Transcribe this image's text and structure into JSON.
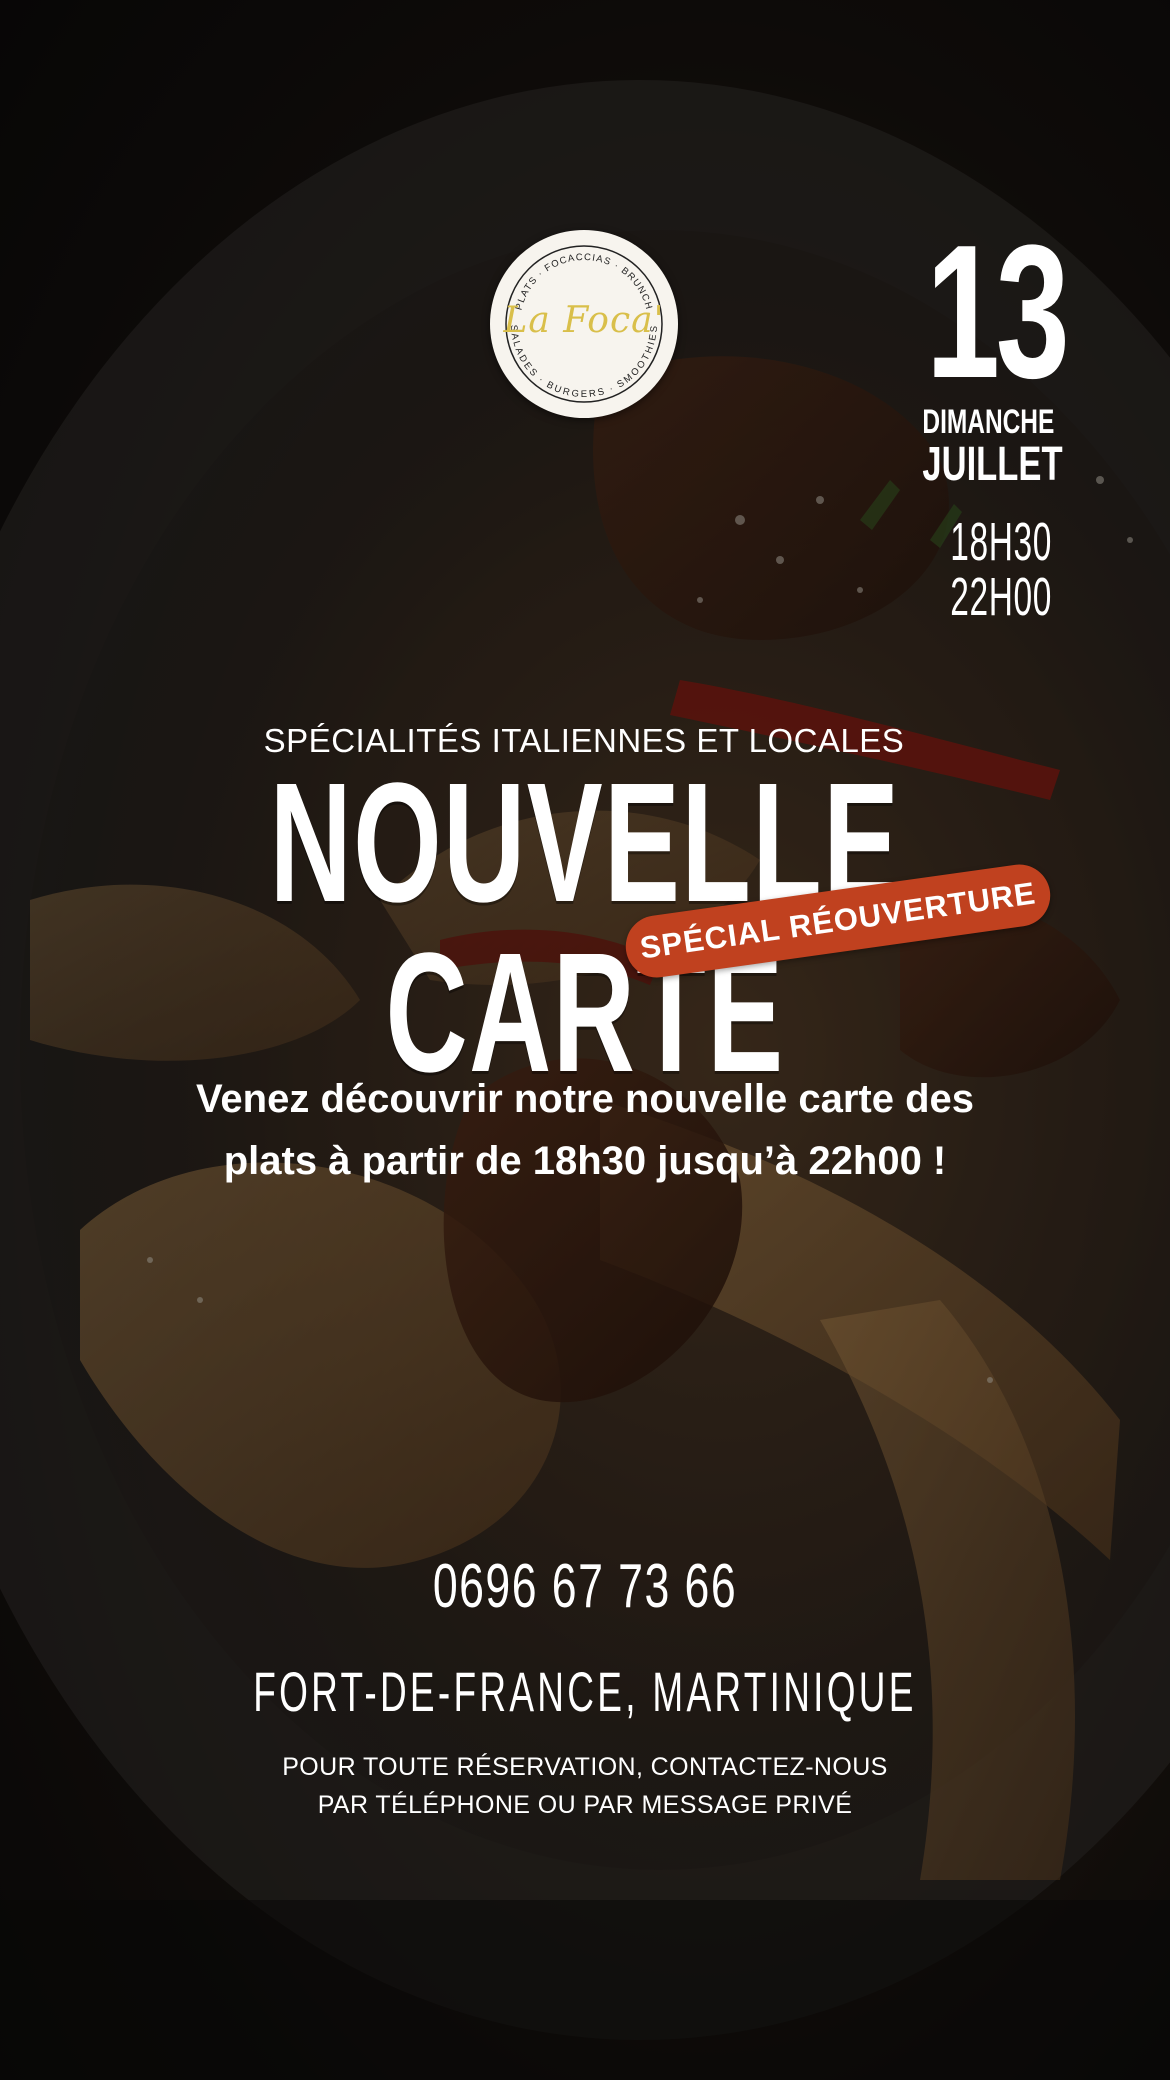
{
  "logo": {
    "brand": "La Foca'",
    "arc_top": "PLATS · FOCACCIAS · BRUNCH",
    "arc_bottom": "SALADES · BURGERS · SMOOTHIES"
  },
  "event": {
    "day": "13",
    "weekday": "DIMANCHE",
    "month": "JUILLET",
    "time_start": "18H30",
    "time_end": "22H00"
  },
  "headline": {
    "kicker": "SPÉCIALITÉS ITALIENNES ET LOCALES",
    "title": "NOUVELLE CARTE",
    "ribbon": "SPÉCIAL RÉOUVERTURE"
  },
  "intro": {
    "line1": "Venez découvrir notre nouvelle carte des",
    "line2": "plats à partir de 18h30 jusqu’à 22h00 !"
  },
  "contact": {
    "phone": "0696 67 73 66",
    "location": "FORT-DE-FRANCE, MARTINIQUE",
    "booking_line1": "POUR TOUTE RÉSERVATION, CONTACTEZ-NOUS",
    "booking_line2": "PAR TÉLÉPHONE OU PAR MESSAGE PRIVÉ"
  },
  "colors": {
    "accent": "#c0411f",
    "logo_gold": "#d9bf4a",
    "text": "#ffffff"
  }
}
